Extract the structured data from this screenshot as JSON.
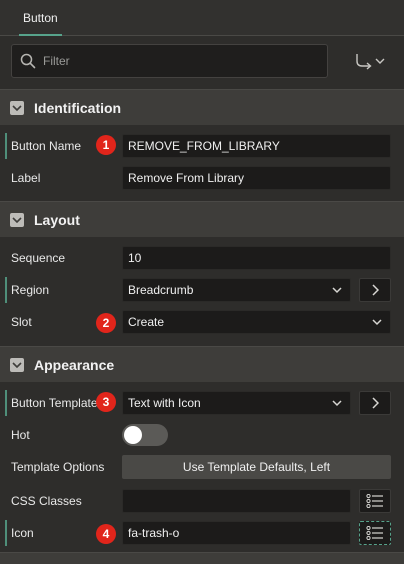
{
  "tab": {
    "label": "Button"
  },
  "filter": {
    "placeholder": "Filter"
  },
  "sections": {
    "identification": {
      "title": "Identification",
      "button_name": {
        "label": "Button Name",
        "value": "REMOVE_FROM_LIBRARY"
      },
      "label_field": {
        "label": "Label",
        "value": "Remove From Library"
      }
    },
    "layout": {
      "title": "Layout",
      "sequence": {
        "label": "Sequence",
        "value": "10"
      },
      "region": {
        "label": "Region",
        "value": "Breadcrumb"
      },
      "slot": {
        "label": "Slot",
        "value": "Create"
      }
    },
    "appearance": {
      "title": "Appearance",
      "button_template": {
        "label": "Button Template",
        "value": "Text with Icon"
      },
      "hot": {
        "label": "Hot",
        "on": false
      },
      "template_options": {
        "label": "Template Options",
        "button_label": "Use Template Defaults, Left"
      },
      "css_classes": {
        "label": "CSS Classes",
        "value": ""
      },
      "icon": {
        "label": "Icon",
        "value": "fa-trash-o"
      }
    }
  },
  "badges": [
    "1",
    "2",
    "3",
    "4"
  ],
  "colors": {
    "accent": "#57a38b",
    "badge": "#e1251b",
    "required_bar": "#4f8f7a"
  },
  "icons": {
    "filter": "search-icon",
    "goto": "goto-arrow-icon",
    "section_toggle": "chevron-down-icon",
    "select": "chevron-down-icon",
    "region_nav": "chevron-right-icon",
    "list_picker": "list-icon"
  }
}
